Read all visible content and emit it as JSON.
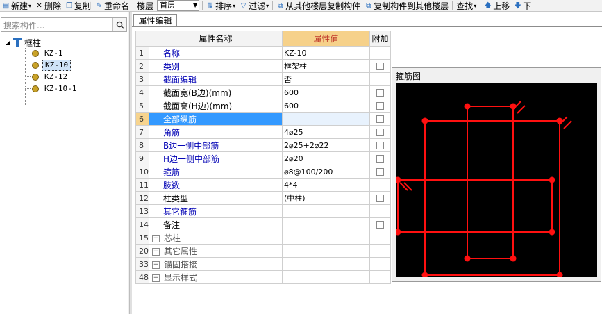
{
  "toolbar": {
    "new": "新建",
    "delete": "删除",
    "copy": "复制",
    "rename": "重命名",
    "floor_label": "楼层",
    "floor_value": "首层",
    "sort": "排序",
    "filter": "过滤",
    "copy_from_floor": "从其他楼层复制构件",
    "copy_to_floor": "复制构件到其他楼层",
    "find": "查找",
    "move_up": "上移",
    "move_down": "下"
  },
  "sidebar": {
    "search_placeholder": "搜索构件...",
    "root_label": "框柱",
    "items": [
      {
        "label": "KZ-1"
      },
      {
        "label": "KZ-10"
      },
      {
        "label": "KZ-12"
      },
      {
        "label": "KZ-10-1"
      }
    ],
    "selected_index": 1
  },
  "tab": {
    "label": "属性编辑"
  },
  "grid": {
    "headers": {
      "name": "属性名称",
      "value": "属性值",
      "extra": "附加"
    },
    "rows": [
      {
        "num": "1",
        "name": "名称",
        "value": "KZ-10",
        "blue": true,
        "checkbox": false
      },
      {
        "num": "2",
        "name": "类别",
        "value": "框架柱",
        "blue": true,
        "checkbox": true
      },
      {
        "num": "3",
        "name": "截面编辑",
        "value": "否",
        "blue": true,
        "checkbox": false
      },
      {
        "num": "4",
        "name": "截面宽(B边)(mm)",
        "value": "600",
        "blue": false,
        "checkbox": true
      },
      {
        "num": "5",
        "name": "截面高(H边)(mm)",
        "value": "600",
        "blue": false,
        "checkbox": true
      },
      {
        "num": "6",
        "name": "全部纵筋",
        "value": "",
        "blue": true,
        "checkbox": true,
        "selected": true
      },
      {
        "num": "7",
        "name": "角筋",
        "value": "4⌀25",
        "blue": true,
        "checkbox": true
      },
      {
        "num": "8",
        "name": "B边一侧中部筋",
        "value": "2⌀25+2⌀22",
        "blue": true,
        "checkbox": true
      },
      {
        "num": "9",
        "name": "H边一侧中部筋",
        "value": "2⌀20",
        "blue": true,
        "checkbox": true
      },
      {
        "num": "10",
        "name": "箍筋",
        "value": "⌀8@100/200",
        "blue": true,
        "checkbox": true
      },
      {
        "num": "11",
        "name": "肢数",
        "value": "4*4",
        "blue": true,
        "checkbox": false
      },
      {
        "num": "12",
        "name": "柱类型",
        "value": "(中柱)",
        "blue": false,
        "checkbox": true
      },
      {
        "num": "13",
        "name": "其它箍筋",
        "value": "",
        "blue": true,
        "checkbox": false
      },
      {
        "num": "14",
        "name": "备注",
        "value": "",
        "blue": false,
        "checkbox": true
      },
      {
        "num": "15",
        "name": "芯柱",
        "value": "",
        "group": true
      },
      {
        "num": "20",
        "name": "其它属性",
        "value": "",
        "group": true
      },
      {
        "num": "33",
        "name": "锚固搭接",
        "value": "",
        "group": true
      },
      {
        "num": "48",
        "name": "显示样式",
        "value": "",
        "group": true
      }
    ]
  },
  "stirrup_panel": {
    "title": "箍筋图"
  },
  "colors": {
    "rebar": "#ff1010",
    "canvas_bg": "#000000",
    "selected_row": "#3399ff",
    "header_value": "#f6d18a"
  }
}
